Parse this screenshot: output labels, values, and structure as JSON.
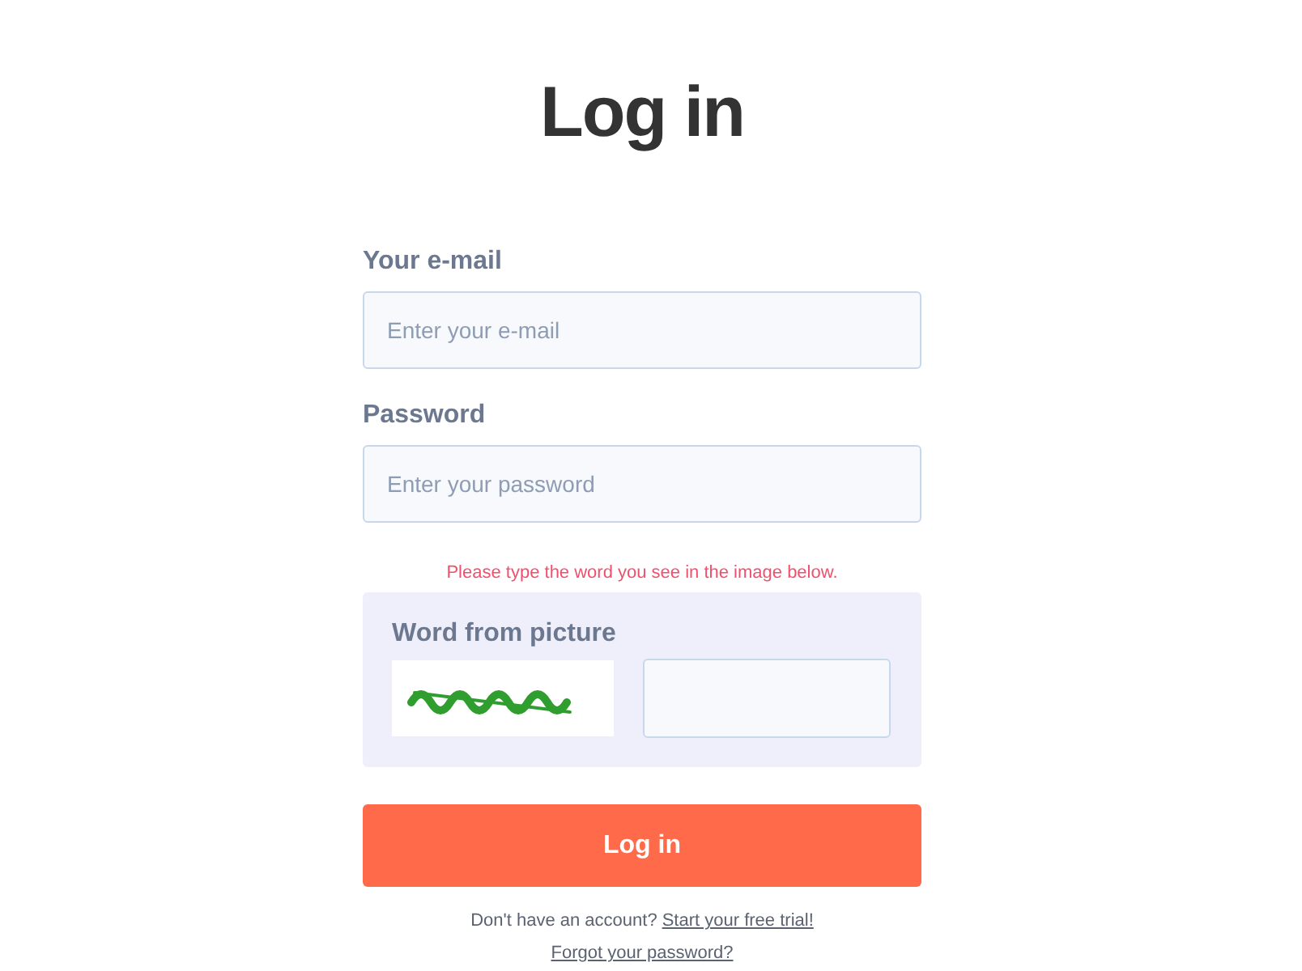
{
  "title": "Log in",
  "fields": [
    {
      "label": "Your e-mail",
      "placeholder": "Enter your e-mail"
    },
    {
      "label": "Password",
      "placeholder": "Enter your password"
    }
  ],
  "captcha": {
    "notice": "Please type the word you see in the image below.",
    "label": "Word from picture"
  },
  "submit": "Log in",
  "footer": {
    "signup_prompt": "Don't have an account?",
    "signup_link": "Start your free trial!",
    "forgot_link": "Forgot your password?"
  }
}
